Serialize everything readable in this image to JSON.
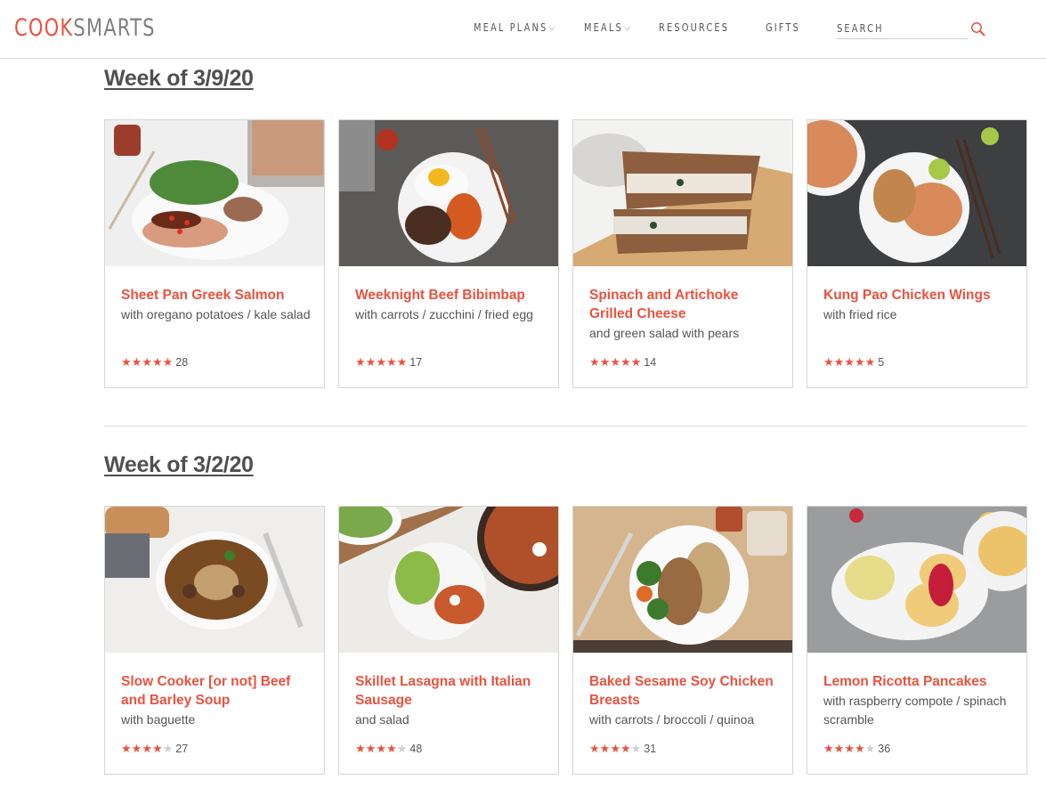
{
  "header": {
    "logo": {
      "part1": "COOK",
      "part2": "SMARTS"
    },
    "nav": [
      {
        "label": "MEAL PLANS",
        "has_dropdown": true
      },
      {
        "label": "MEALS",
        "has_dropdown": true
      },
      {
        "label": "RESOURCES",
        "has_dropdown": false
      },
      {
        "label": "GIFTS",
        "has_dropdown": false
      }
    ],
    "search": {
      "placeholder": "SEARCH",
      "value": "",
      "icon": "search-icon"
    }
  },
  "colors": {
    "brand": "#e8533f",
    "logo_gray": "#808080",
    "text": "#555555",
    "star_off": "#cfcfcf"
  },
  "weeks": [
    {
      "title": "Week of 3/9/20",
      "meals": [
        {
          "title": "Sheet Pan Greek Salmon",
          "subtitle": "with oregano potatoes / kale salad",
          "stars": 5,
          "reviews": "28",
          "image": "salmon with kale salad and potatoes"
        },
        {
          "title": "Weeknight Beef Bibimbap",
          "subtitle": "with carrots / zucchini / fried egg",
          "stars": 5,
          "reviews": "17",
          "image": "bibimbap bowl with egg and chopsticks"
        },
        {
          "title": "Spinach and Artichoke Grilled Cheese",
          "subtitle": "and green salad with pears",
          "stars": 5,
          "reviews": "14",
          "image": "grilled cheese sandwich on cutting board"
        },
        {
          "title": "Kung Pao Chicken Wings",
          "subtitle": "with fried rice",
          "stars": 5,
          "reviews": "5",
          "image": "chicken wings with fried rice"
        }
      ]
    },
    {
      "title": "Week of 3/2/20",
      "meals": [
        {
          "title": "Slow Cooker [or not] Beef and Barley Soup",
          "subtitle": "with baguette",
          "stars": 4,
          "reviews": "27",
          "image": "beef barley soup bowl"
        },
        {
          "title": "Skillet Lasagna with Italian Sausage",
          "subtitle": "and salad",
          "stars": 4,
          "reviews": "48",
          "image": "skillet lasagna with salad"
        },
        {
          "title": "Baked Sesame Soy Chicken Breasts",
          "subtitle": "with carrots / broccoli / quinoa",
          "stars": 4,
          "reviews": "31",
          "image": "chicken breast with broccoli and quinoa"
        },
        {
          "title": "Lemon Ricotta Pancakes",
          "subtitle": "with raspberry compote / spinach scramble",
          "stars": 4,
          "reviews": "36",
          "image": "pancakes with raspberry compote"
        }
      ]
    }
  ]
}
